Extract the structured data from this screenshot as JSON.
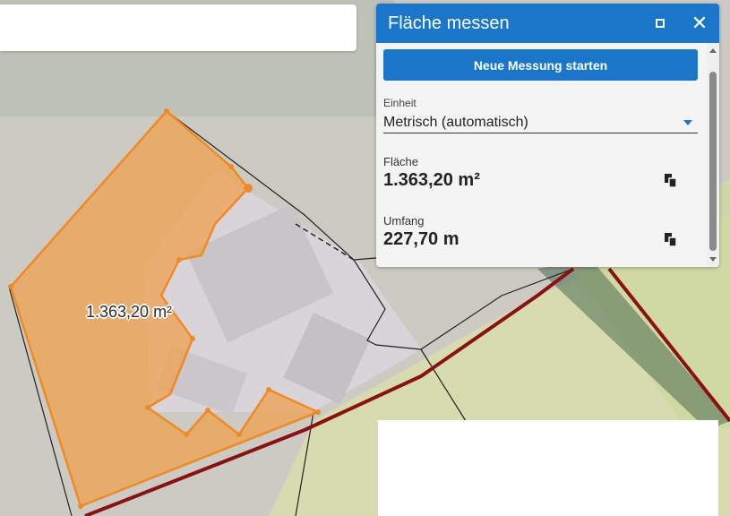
{
  "map": {
    "area_label": "1.363,20 m²",
    "colors": {
      "measure_fill": "#f0a04a",
      "measure_stroke": "#f08a24",
      "road_red": "#8b1010",
      "field_green": "#d4d9a8",
      "background": "#cfcfc8"
    }
  },
  "panel": {
    "title": "Fläche messen",
    "maximize_icon": "maximize-icon",
    "close_icon": "close-icon",
    "close_glyph": "✕",
    "start_button": "Neue Messung starten",
    "unit_label": "Einheit",
    "unit_value": "Metrisch (automatisch)",
    "area_label": "Fläche",
    "area_value": "1.363,20 m²",
    "perimeter_label": "Umfang",
    "perimeter_value": "227,70 m",
    "accent_color": "#1976c8"
  }
}
